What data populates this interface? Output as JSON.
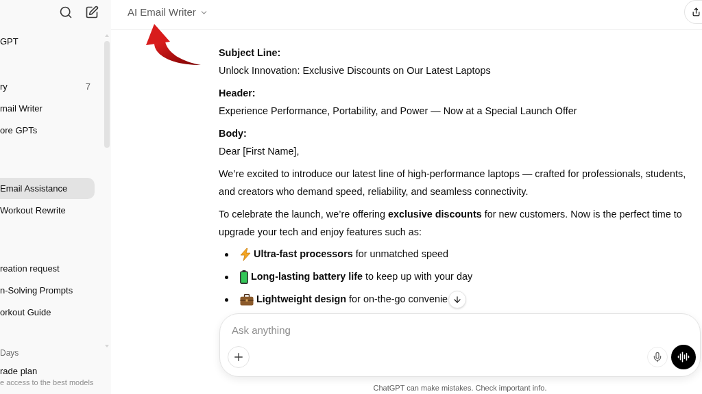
{
  "sidebar": {
    "groups": [
      {
        "items": [
          {
            "label": "GPT",
            "selected": false
          }
        ]
      },
      {
        "items": [
          {
            "label": "ry",
            "count": "7",
            "selected": false
          },
          {
            "label": "mail Writer",
            "selected": false
          },
          {
            "label": "ore GPTs",
            "selected": false
          }
        ]
      },
      {
        "items": [
          {
            "label": "Email Assistance",
            "selected": true
          },
          {
            "label": "Workout Rewrite",
            "selected": false
          }
        ]
      },
      {
        "items": [
          {
            "label": "reation request",
            "selected": false
          },
          {
            "label": "n-Solving Prompts",
            "selected": false
          },
          {
            "label": "orkout Guide",
            "selected": false
          }
        ]
      }
    ],
    "section_heading": "Days",
    "upgrade": {
      "title": "rade plan",
      "subtitle": "e access to the best models"
    }
  },
  "header": {
    "title": "AI Email Writer"
  },
  "message": {
    "blocks": [
      {
        "kind": "label",
        "text": "Subject Line:"
      },
      {
        "kind": "text",
        "text": "Unlock Innovation: Exclusive Discounts on Our Latest Laptops"
      },
      {
        "kind": "label",
        "text": "Header:"
      },
      {
        "kind": "text",
        "text": "Experience Performance, Portability, and Power — Now at a Special Launch Offer"
      },
      {
        "kind": "label",
        "text": "Body:"
      },
      {
        "kind": "text",
        "text": "Dear [First Name],"
      },
      {
        "kind": "paragraph",
        "text": "We’re excited to introduce our latest line of high-performance laptops — crafted for professionals, students, and creators who demand speed, reliability, and seamless connectivity."
      },
      {
        "kind": "paragraph",
        "text": "To celebrate the launch, we’re offering **exclusive discounts** for new customers. Now is the perfect time to upgrade your tech and enjoy features such as:"
      },
      {
        "kind": "bullets",
        "items": [
          "**Ultra-fast processors** for unmatched speed",
          "**Long-lasting battery life** to keep up with your day",
          "**Lightweight design** for on-the-go convenie"
        ]
      }
    ]
  },
  "composer": {
    "placeholder": "Ask anything"
  },
  "footer_note": "ChatGPT can make mistakes. Check important info."
}
